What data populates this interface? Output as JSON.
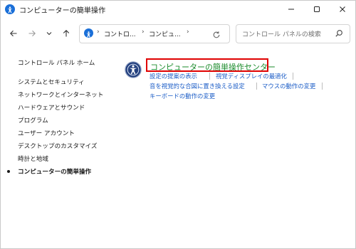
{
  "window": {
    "title": "コンピューターの簡単操作",
    "controls": [
      "minimize",
      "maximize",
      "close"
    ]
  },
  "nav": {
    "breadcrumbs": [
      "コントロ...",
      "コンピュ..."
    ],
    "search_placeholder": "コントロール パネルの検索"
  },
  "sidebar": {
    "home_label": "コントロール パネル ホーム",
    "items": [
      {
        "label": "システムとセキュリティ",
        "current": false
      },
      {
        "label": "ネットワークとインターネット",
        "current": false
      },
      {
        "label": "ハードウェアとサウンド",
        "current": false
      },
      {
        "label": "プログラム",
        "current": false
      },
      {
        "label": "ユーザー アカウント",
        "current": false
      },
      {
        "label": "デスクトップのカスタマイズ",
        "current": false
      },
      {
        "label": "時計と地域",
        "current": false
      },
      {
        "label": "コンピューターの簡単操作",
        "current": true
      }
    ]
  },
  "main": {
    "category_title": "コンピューターの簡単操作センター",
    "tasks": [
      "設定の提案の表示",
      "視覚ディスプレイの最適化",
      "音を視覚的な合図に置き換える設定",
      "マウスの動作の変更",
      "キーボードの動作の変更"
    ]
  },
  "colors": {
    "link": "#1d5ec7",
    "category_title": "#1a8a2a",
    "highlight_border": "#e00000",
    "accent_icon": "#1a6fd8"
  }
}
